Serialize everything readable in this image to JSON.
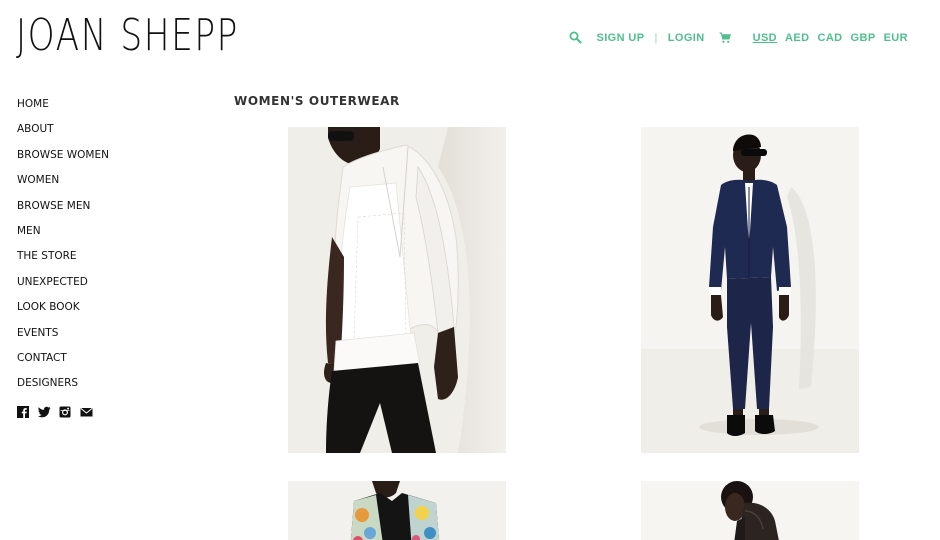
{
  "brand": {
    "name": "JOAN SHEPP"
  },
  "header": {
    "links": {
      "signup": "SIGN UP",
      "divider": "|",
      "login": "LOGIN"
    },
    "currencies": [
      "USD",
      "AED",
      "CAD",
      "GBP",
      "EUR"
    ],
    "accent_color": "#4fc08d"
  },
  "sidebar": {
    "items": [
      "HOME",
      "ABOUT",
      "BROWSE WOMEN",
      "WOMEN",
      "BROWSE MEN",
      "MEN",
      "THE STORE",
      "UNEXPECTED",
      "LOOK BOOK",
      "EVENTS",
      "CONTACT",
      "DESIGNERS"
    ],
    "social": [
      "facebook-icon",
      "twitter-icon",
      "instagram-icon",
      "email-icon"
    ]
  },
  "main": {
    "title": "WOMEN'S OUTERWEAR",
    "products": [
      {
        "image": "woman-white-blazer-photo"
      },
      {
        "image": "woman-navy-suit-photo"
      },
      {
        "image": "woman-floral-jacket-photo"
      },
      {
        "image": "woman-dark-hooded-jacket-photo"
      }
    ]
  }
}
